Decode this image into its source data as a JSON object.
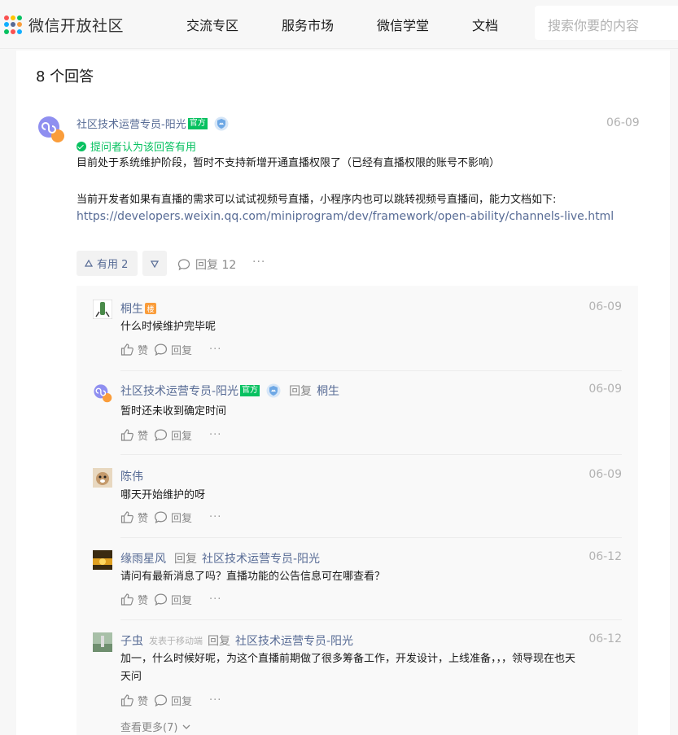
{
  "header": {
    "logo_text": "微信开放社区",
    "nav": [
      "交流专区",
      "服务市场",
      "微信学堂",
      "文档"
    ],
    "search_placeholder": "搜索你要的内容"
  },
  "answers_count": "8 个回答",
  "answer": {
    "author": "社区技术运营专员-阳光",
    "official_badge": "官方",
    "date": "06-09",
    "accepted_text": "提问者认为该回答有用",
    "body_line1": "目前处于系统维护阶段，暂时不支持新增开通直播权限了（已经有直播权限的账号不影响）",
    "body_line2": "当前开发者如果有直播的需求可以试试视频号直播，小程序内也可以跳转视频号直播间，能力文档如下:",
    "link": "https://developers.weixin.qq.com/miniprogram/dev/framework/open-ability/channels-live.html",
    "useful_label": "有用 2",
    "reply_label": "回复 12",
    "more": "···"
  },
  "replies": [
    {
      "author": "桐生",
      "lou_badge": "楼",
      "date": "06-09",
      "text": "什么时候维护完毕呢",
      "like": "赞",
      "reply": "回复",
      "more": "···"
    },
    {
      "author": "社区技术运营专员-阳光",
      "official_badge": "官方",
      "reply_word": "回复",
      "reply_to": "桐生",
      "date": "06-09",
      "text": "暂时还未收到确定时间",
      "like": "赞",
      "reply": "回复",
      "more": "···"
    },
    {
      "author": "陈伟",
      "date": "06-09",
      "text": "哪天开始维护的呀",
      "like": "赞",
      "reply": "回复",
      "more": "···"
    },
    {
      "author": "缘雨星风",
      "reply_word": "回复",
      "reply_to": "社区技术运营专员-阳光",
      "date": "06-12",
      "text": "请问有最新消息了吗？直播功能的公告信息可在哪查看？",
      "like": "赞",
      "reply": "回复",
      "more": "···"
    },
    {
      "author": "子虫",
      "via": "发表于移动端",
      "reply_word": "回复",
      "reply_to": "社区技术运营专员-阳光",
      "date": "06-12",
      "text_line1": "加一，什么时候好呢，为这个直播前期做了很多筹备工作，开发设计，上线准备，，，领导现在也天",
      "text_line2": "天问",
      "like": "赞",
      "reply": "回复",
      "more": "···"
    }
  ],
  "see_more": "查看更多(7)",
  "colors": {
    "green": "#07c160",
    "link": "#576b95",
    "orange": "#fa9d3b"
  }
}
